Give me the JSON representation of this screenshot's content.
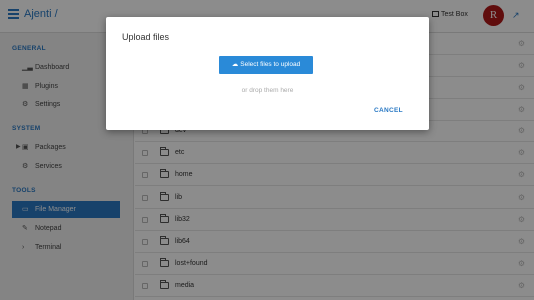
{
  "header": {
    "brand": "Ajenti /",
    "testbox_label": "Test Box",
    "avatar_letter": "R"
  },
  "sidebar": {
    "sections": [
      {
        "title": "GENERAL",
        "items": [
          {
            "label": "Dashboard",
            "icon": "bar-chart-icon"
          },
          {
            "label": "Plugins",
            "icon": "grid-icon"
          },
          {
            "label": "Settings",
            "icon": "gear-icon"
          }
        ]
      },
      {
        "title": "SYSTEM",
        "items": [
          {
            "label": "Packages",
            "icon": "package-icon"
          },
          {
            "label": "Services",
            "icon": "cogs-icon"
          }
        ]
      },
      {
        "title": "TOOLS",
        "items": [
          {
            "label": "File Manager",
            "icon": "folder-icon",
            "active": true
          },
          {
            "label": "Notepad",
            "icon": "pencil-icon"
          },
          {
            "label": "Terminal",
            "icon": "terminal-icon"
          }
        ]
      }
    ]
  },
  "files": [
    {
      "name": "dev"
    },
    {
      "name": "etc"
    },
    {
      "name": "home"
    },
    {
      "name": "lib"
    },
    {
      "name": "lib32"
    },
    {
      "name": "lib64"
    },
    {
      "name": "lost+found"
    },
    {
      "name": "media"
    }
  ],
  "modal": {
    "title": "Upload files",
    "upload_button": "Select files to upload",
    "drop_text": "or drop them here",
    "cancel_button": "CANCEL"
  },
  "colors": {
    "accent": "#2a79c4",
    "button": "#2a8ad8",
    "avatar": "#b01818"
  }
}
